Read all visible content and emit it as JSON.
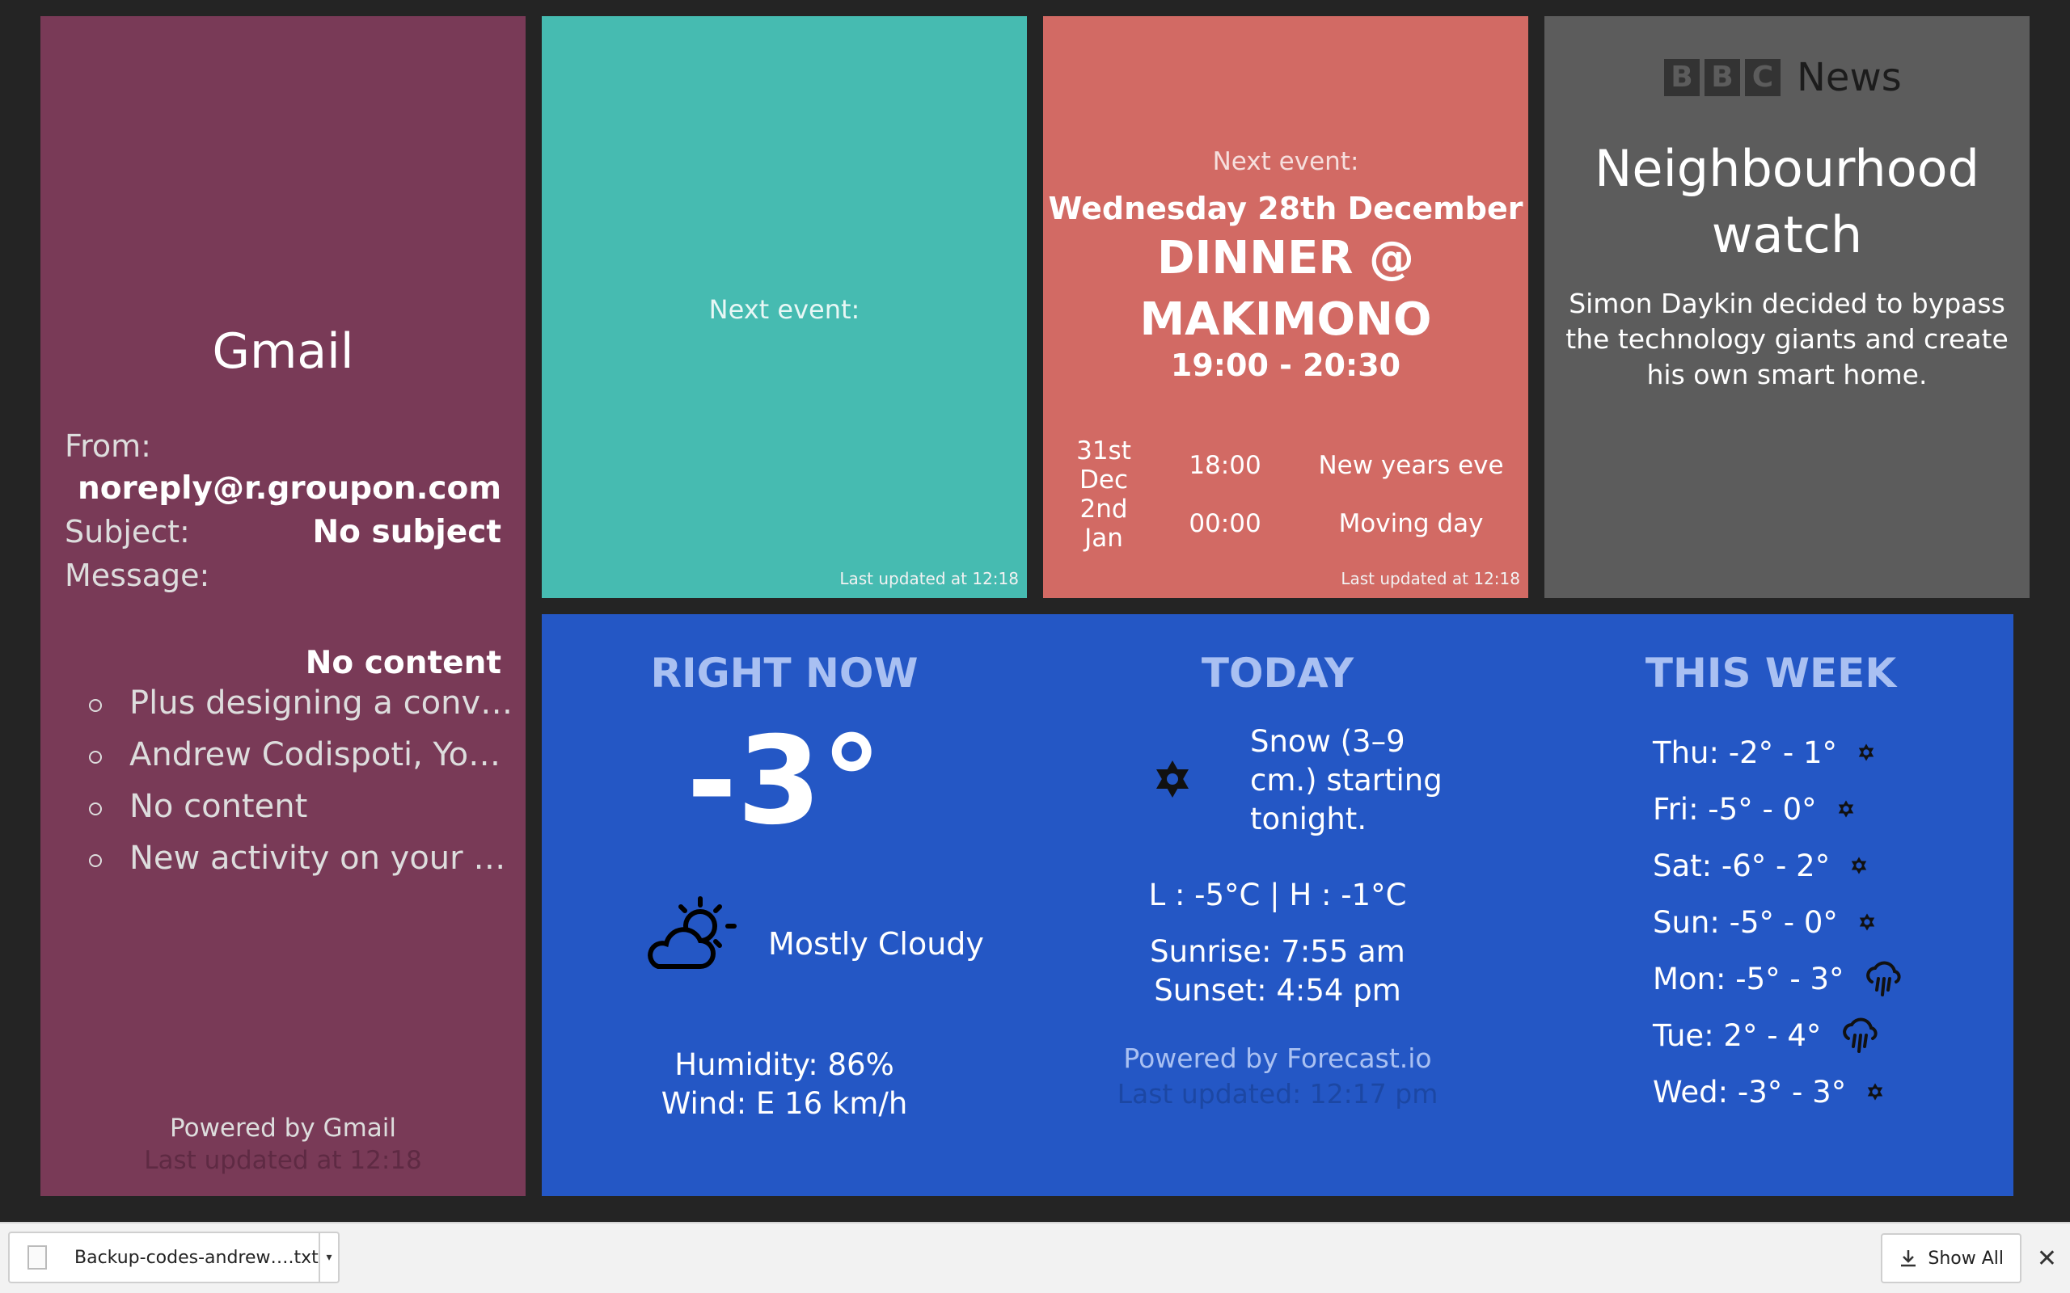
{
  "gmail": {
    "title": "Gmail",
    "from_label": "From:",
    "from_value": "noreply@r.groupon.com",
    "subject_label": "Subject:",
    "subject_value": "No subject",
    "message_label": "Message:",
    "message_value": "No content",
    "items": [
      "Plus designing a conv…",
      "Andrew Codispoti, Yo…",
      "No content",
      "New activity on your …"
    ],
    "powered": "Powered by Gmail",
    "updated": "Last updated at 12:18"
  },
  "calendar_1": {
    "label": "Next event:",
    "updated": "Last updated at 12:18"
  },
  "calendar_2": {
    "label": "Next event:",
    "date": "Wednesday 28th December",
    "name": "DINNER @ MAKIMONO",
    "time": "19:00 - 20:30",
    "upcoming": [
      {
        "date": "31st Dec",
        "time": "18:00",
        "title": "New years eve"
      },
      {
        "date": "2nd Jan",
        "time": "00:00",
        "title": "Moving day"
      }
    ],
    "updated": "Last updated at 12:18"
  },
  "bbc": {
    "logo_letters": [
      "B",
      "B",
      "C"
    ],
    "logo_news": "News",
    "headline": "Neighbourhood watch",
    "summary": "Simon Daykin decided to bypass the technology giants and create his own smart home."
  },
  "weather": {
    "now": {
      "heading": "RIGHT NOW",
      "temp": "-3°",
      "icon": "partly-cloudy-icon",
      "condition": "Mostly Cloudy",
      "humidity": "Humidity: 86%",
      "wind": "Wind: E 16 km/h"
    },
    "today": {
      "heading": "TODAY",
      "icon": "snow-icon",
      "summary": "Snow (3–9 cm.) starting tonight.",
      "lowhigh": "L : -5°C | H : -1°C",
      "sunrise": "Sunrise: 7:55 am",
      "sunset": "Sunset: 4:54 pm",
      "powered": "Powered by Forecast.io",
      "updated": "Last updated: 12:17 pm"
    },
    "week": {
      "heading": "THIS WEEK",
      "days": [
        {
          "text": "Thu: -2° - 1°",
          "icon": "snow"
        },
        {
          "text": "Fri: -5° - 0°",
          "icon": "snow"
        },
        {
          "text": "Sat: -6° - 2°",
          "icon": "snow"
        },
        {
          "text": "Sun: -5° - 0°",
          "icon": "snow"
        },
        {
          "text": "Mon: -5° - 3°",
          "icon": "rain"
        },
        {
          "text": "Tue: 2° - 4°",
          "icon": "rain"
        },
        {
          "text": "Wed: -3° - 3°",
          "icon": "snow"
        }
      ]
    }
  },
  "downloads": {
    "file": "Backup-codes-andrew….txt",
    "show_all": "Show All"
  }
}
